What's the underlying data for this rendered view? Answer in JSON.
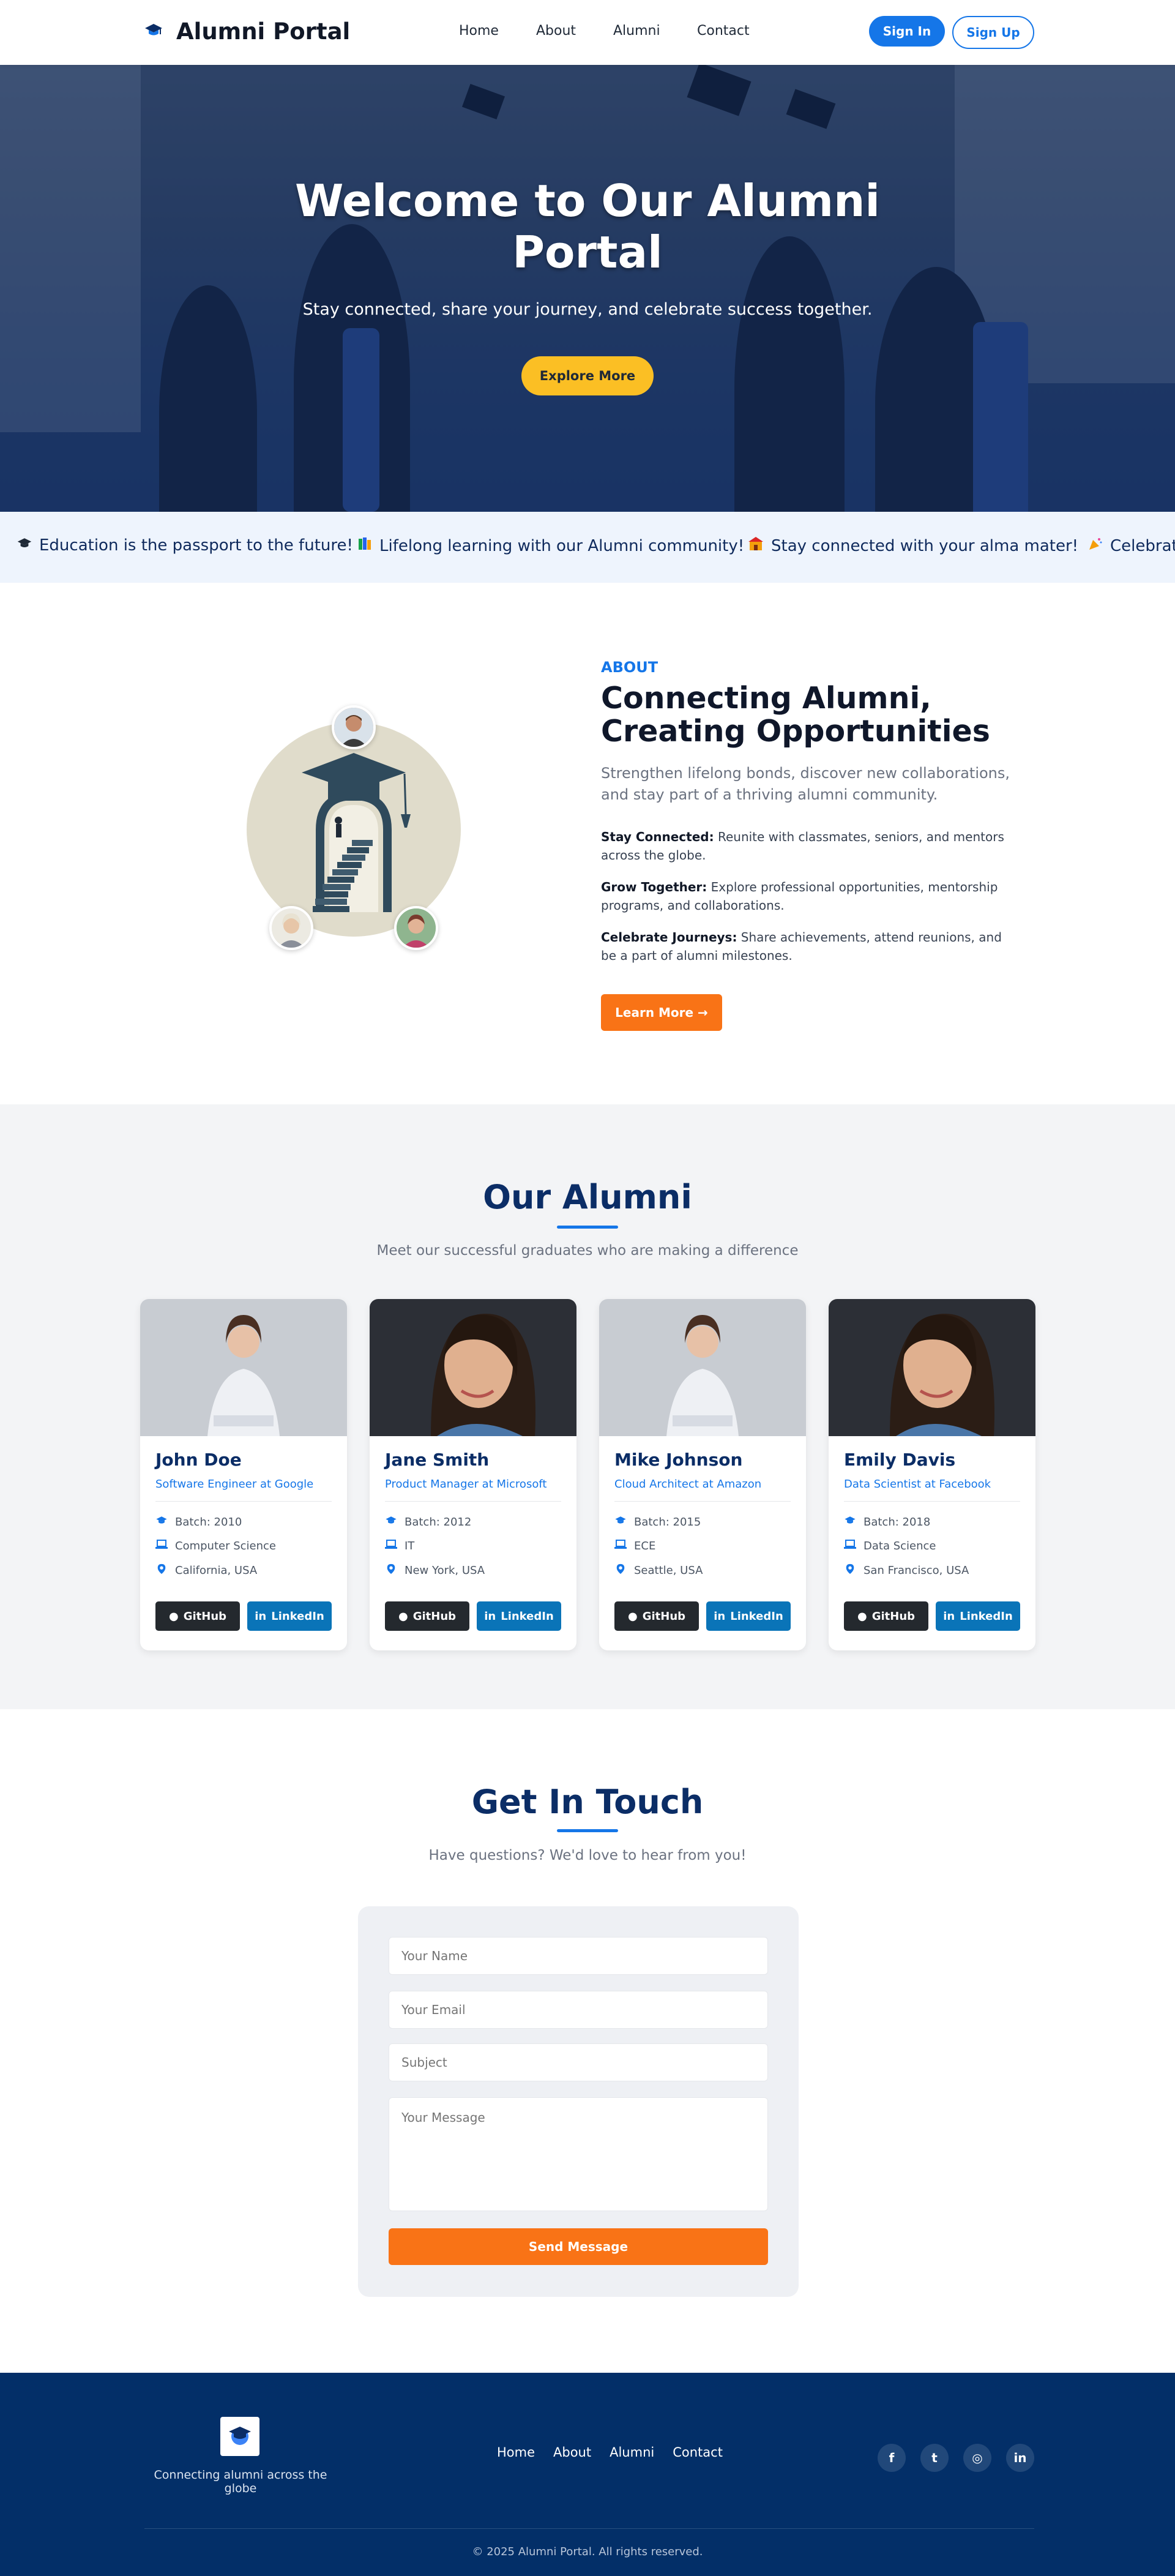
{
  "header": {
    "brand_title": "Alumni Portal",
    "nav": [
      "Home",
      "About",
      "Alumni",
      "Contact"
    ],
    "sign_in": "Sign In",
    "sign_up": "Sign Up"
  },
  "hero": {
    "title": "Welcome to Our Alumni Portal",
    "subtitle": "Stay connected, share your journey, and celebrate success together.",
    "cta": "Explore More"
  },
  "ticker": {
    "items": [
      {
        "icon": "graduation-cap-icon",
        "text": "Education is the passport to the future!"
      },
      {
        "icon": "books-icon",
        "text": "Lifelong learning with our Alumni community!"
      },
      {
        "icon": "school-icon",
        "text": "Stay connected with your alma mater!"
      },
      {
        "icon": "party-popper-icon",
        "text": "Celebrat"
      }
    ]
  },
  "about": {
    "eyebrow": "ABOUT",
    "title": "Connecting Alumni, Creating Opportunities",
    "lead": "Strengthen lifelong bonds, discover new collaborations, and stay part of a thriving alumni community.",
    "points": [
      {
        "title": "Stay Connected:",
        "text": " Reunite with classmates, seniors, and mentors across the globe."
      },
      {
        "title": "Grow Together:",
        "text": " Explore professional opportunities, mentorship programs, and collaborations."
      },
      {
        "title": "Celebrate Journeys:",
        "text": " Share achievements, attend reunions, and be a part of alumni milestones."
      }
    ],
    "cta": "Learn More →"
  },
  "alumni": {
    "title": "Our Alumni",
    "subtitle": "Meet our successful graduates who are making a difference",
    "cards": [
      {
        "name": "John Doe",
        "role": "Software Engineer at Google",
        "batch": "Batch: 2010",
        "dept": "Computer Science",
        "location": "California, USA",
        "github": "GitHub",
        "linkedin": "LinkedIn"
      },
      {
        "name": "Jane Smith",
        "role": "Product Manager at Microsoft",
        "batch": "Batch: 2012",
        "dept": "IT",
        "location": "New York, USA",
        "github": "GitHub",
        "linkedin": "LinkedIn"
      },
      {
        "name": "Mike Johnson",
        "role": "Cloud Architect at Amazon",
        "batch": "Batch: 2015",
        "dept": "ECE",
        "location": "Seattle, USA",
        "github": "GitHub",
        "linkedin": "LinkedIn"
      },
      {
        "name": "Emily Davis",
        "role": "Data Scientist at Facebook",
        "batch": "Batch: 2018",
        "dept": "Data Science",
        "location": "San Francisco, USA",
        "github": "GitHub",
        "linkedin": "LinkedIn"
      }
    ]
  },
  "contact": {
    "title": "Get In Touch",
    "subtitle": "Have questions? We'd love to hear from you!",
    "name_placeholder": "Your Name",
    "email_placeholder": "Your Email",
    "subject_placeholder": "Subject",
    "message_placeholder": "Your Message",
    "submit": "Send Message"
  },
  "footer": {
    "tagline": "Connecting alumni across the globe",
    "links": [
      "Home",
      "About",
      "Alumni",
      "Contact"
    ],
    "social": [
      {
        "icon": "facebook-icon",
        "glyph": "f"
      },
      {
        "icon": "twitter-icon",
        "glyph": "t"
      },
      {
        "icon": "instagram-icon",
        "glyph": "◎"
      },
      {
        "icon": "linkedin-icon",
        "glyph": "in"
      }
    ],
    "copyright": "© 2025 Alumni Portal. All rights reserved."
  },
  "colors": {
    "primary": "#1576e8",
    "accent_orange": "#f97316",
    "accent_yellow": "#fbbf24",
    "navy": "#032f68",
    "heading": "#0b2d66"
  }
}
